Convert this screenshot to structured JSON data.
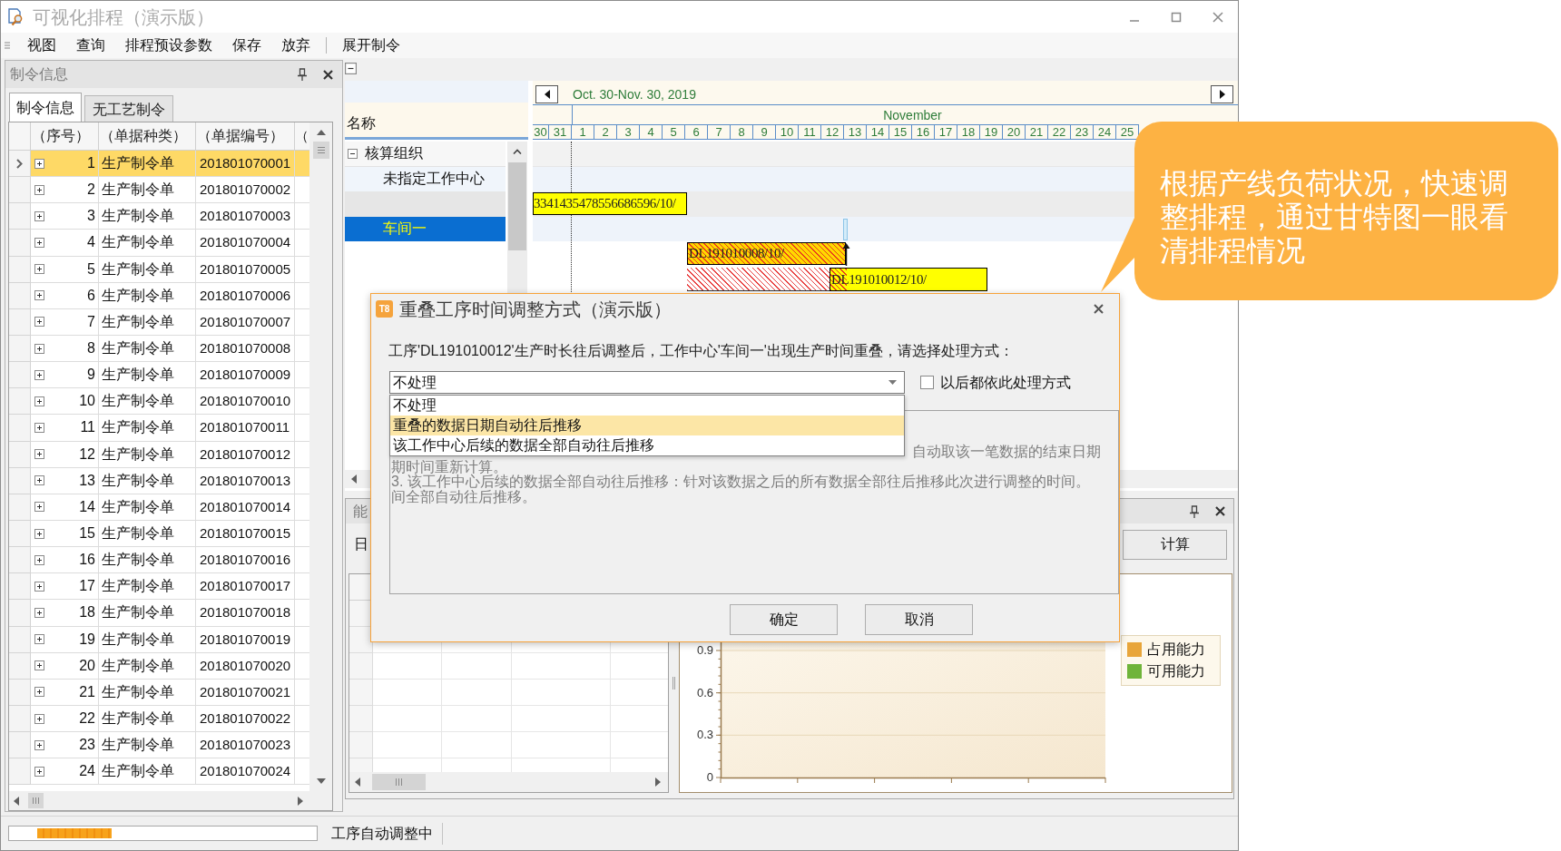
{
  "window": {
    "title": "可视化排程（演示版）"
  },
  "menu_groups": [
    {
      "items": [
        "视图",
        "查询",
        "排程预设参数",
        "保存",
        "放弃"
      ]
    },
    {
      "items": [
        "展开制令"
      ]
    }
  ],
  "side_panel": {
    "title": "制令信息",
    "tabs": [
      {
        "label": "制令信息",
        "selected": true
      },
      {
        "label": "无工艺制令",
        "selected": false
      }
    ],
    "table": {
      "columns": [
        "（序号）",
        "（单据种类）",
        "（单据编号）",
        "（"
      ],
      "rows": [
        {
          "seq": "1",
          "type": "生产制令单",
          "number": "201801070001",
          "selected": true
        },
        {
          "seq": "2",
          "type": "生产制令单",
          "number": "201801070002",
          "selected": false
        },
        {
          "seq": "3",
          "type": "生产制令单",
          "number": "201801070003",
          "selected": false
        },
        {
          "seq": "4",
          "type": "生产制令单",
          "number": "201801070004",
          "selected": false
        },
        {
          "seq": "5",
          "type": "生产制令单",
          "number": "201801070005",
          "selected": false
        },
        {
          "seq": "6",
          "type": "生产制令单",
          "number": "201801070006",
          "selected": false
        },
        {
          "seq": "7",
          "type": "生产制令单",
          "number": "201801070007",
          "selected": false
        },
        {
          "seq": "8",
          "type": "生产制令单",
          "number": "201801070008",
          "selected": false
        },
        {
          "seq": "9",
          "type": "生产制令单",
          "number": "201801070009",
          "selected": false
        },
        {
          "seq": "10",
          "type": "生产制令单",
          "number": "201801070010",
          "selected": false
        },
        {
          "seq": "11",
          "type": "生产制令单",
          "number": "201801070011",
          "selected": false
        },
        {
          "seq": "12",
          "type": "生产制令单",
          "number": "201801070012",
          "selected": false
        },
        {
          "seq": "13",
          "type": "生产制令单",
          "number": "201801070013",
          "selected": false
        },
        {
          "seq": "14",
          "type": "生产制令单",
          "number": "201801070014",
          "selected": false
        },
        {
          "seq": "15",
          "type": "生产制令单",
          "number": "201801070015",
          "selected": false
        },
        {
          "seq": "16",
          "type": "生产制令单",
          "number": "201801070016",
          "selected": false
        },
        {
          "seq": "17",
          "type": "生产制令单",
          "number": "201801070017",
          "selected": false
        },
        {
          "seq": "18",
          "type": "生产制令单",
          "number": "201801070018",
          "selected": false
        },
        {
          "seq": "19",
          "type": "生产制令单",
          "number": "201801070019",
          "selected": false
        },
        {
          "seq": "20",
          "type": "生产制令单",
          "number": "201801070020",
          "selected": false
        },
        {
          "seq": "21",
          "type": "生产制令单",
          "number": "201801070021",
          "selected": false
        },
        {
          "seq": "22",
          "type": "生产制令单",
          "number": "201801070022",
          "selected": false
        },
        {
          "seq": "23",
          "type": "生产制令单",
          "number": "201801070023",
          "selected": false
        },
        {
          "seq": "24",
          "type": "生产制令单",
          "number": "201801070024",
          "selected": false
        }
      ]
    }
  },
  "gantt": {
    "range": "Oct. 30-Nov. 30, 2019",
    "name_header": "名称",
    "month": "November",
    "days": [
      "30",
      "31",
      "1",
      "2",
      "3",
      "4",
      "5",
      "6",
      "7",
      "8",
      "9",
      "10",
      "11",
      "12",
      "13",
      "14",
      "15",
      "16",
      "17",
      "18",
      "19",
      "20",
      "21",
      "22",
      "23",
      "24",
      "25"
    ],
    "tree": [
      {
        "label": "核算组织",
        "expanded": true,
        "children": [
          {
            "label": "未指定工作中心",
            "selected": false,
            "tasks": [
              {
                "label": "3341435478556686596/10/",
                "kind": "normal"
              }
            ]
          },
          {
            "label": "车间一",
            "selected": true,
            "tasks": [
              {
                "label": "DL191010008/10/",
                "kind": "conflict"
              },
              {
                "label": "DL191010012/10/",
                "kind": "shifted"
              }
            ]
          }
        ]
      }
    ]
  },
  "lower_panel": {
    "title": "能",
    "date_label": "日",
    "calc_button": "计算",
    "chart_data": {
      "type": "bar",
      "ylim": [
        0,
        1
      ],
      "yticks": [
        0,
        0.3,
        0.6,
        0.9
      ],
      "grid": true,
      "series": [
        {
          "name": "占用能力",
          "color": "#e8a53a"
        },
        {
          "name": "可用能力",
          "color": "#6fb43a"
        }
      ]
    }
  },
  "dialog": {
    "logo": "T8",
    "title": "重叠工序时间调整方式（演示版）",
    "message": "工序'DL191010012'生产时长往后调整后，工作中心'车间一'出现生产时间重叠，请选择处理方式：",
    "combo_value": "不处理",
    "options": [
      {
        "label": "不处理",
        "selected": false
      },
      {
        "label": "重叠的数据日期自动往后推移",
        "selected": true
      },
      {
        "label": "该工作中心后续的数据全部自动往后推移",
        "selected": false
      }
    ],
    "remember": {
      "label": "以后都依此处理方式",
      "checked": false
    },
    "description": {
      "first_line_tail": "自动取该一笔数据的结束日期",
      "lines": [
        "期时间重新计算。",
        "3. 该工作中心后续的数据全部自动往后推移：针对该数据之后的所有数据全部往后推移此次进行调整的时间。",
        "间全部自动往后推移。"
      ]
    },
    "buttons": [
      "确定",
      "取消"
    ]
  },
  "status_bar": {
    "progress": {
      "indeterminate": true
    },
    "text": "工序自动调整中"
  },
  "callout": {
    "text": "根据产线负荷状况，快速调整排程，通过甘特图一眼看清排程情况"
  }
}
